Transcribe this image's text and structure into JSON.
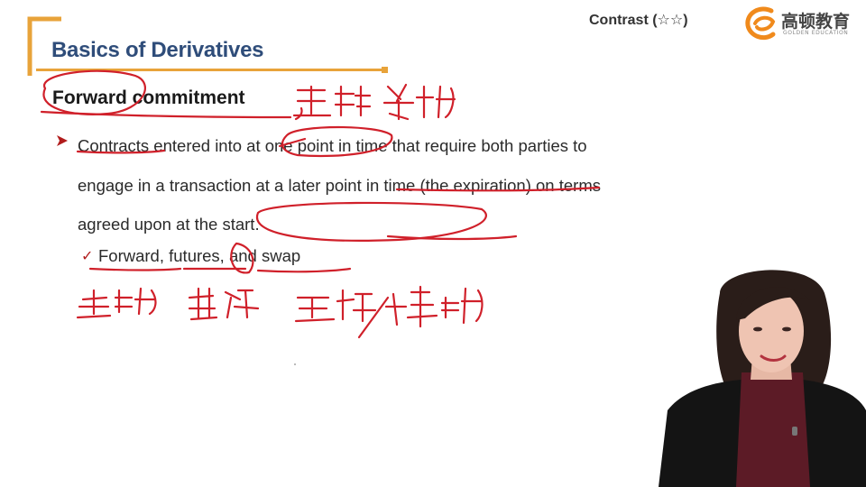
{
  "header": {
    "contrast_label": "Contrast (☆☆)",
    "logo_cn": "高顿教育",
    "logo_en": "GOLDEN EDUCATION"
  },
  "slide": {
    "title": "Basics of Derivatives",
    "heading": "Forward commitment",
    "bullet_text": "Contracts entered into at one point in time that require both parties to engage in a transaction at a later point in time (the expiration) on terms agreed upon at the start.",
    "sub_item": "Forward, futures, and swap"
  },
  "colors": {
    "title": "#2f4d7a",
    "accent": "#e8a33a",
    "ink": "#d0202a",
    "bullet": "#b11c1c"
  },
  "icons": {
    "bullet": "triangle-arrow-icon",
    "check": "check-icon",
    "logo": "golden-education-logo"
  }
}
